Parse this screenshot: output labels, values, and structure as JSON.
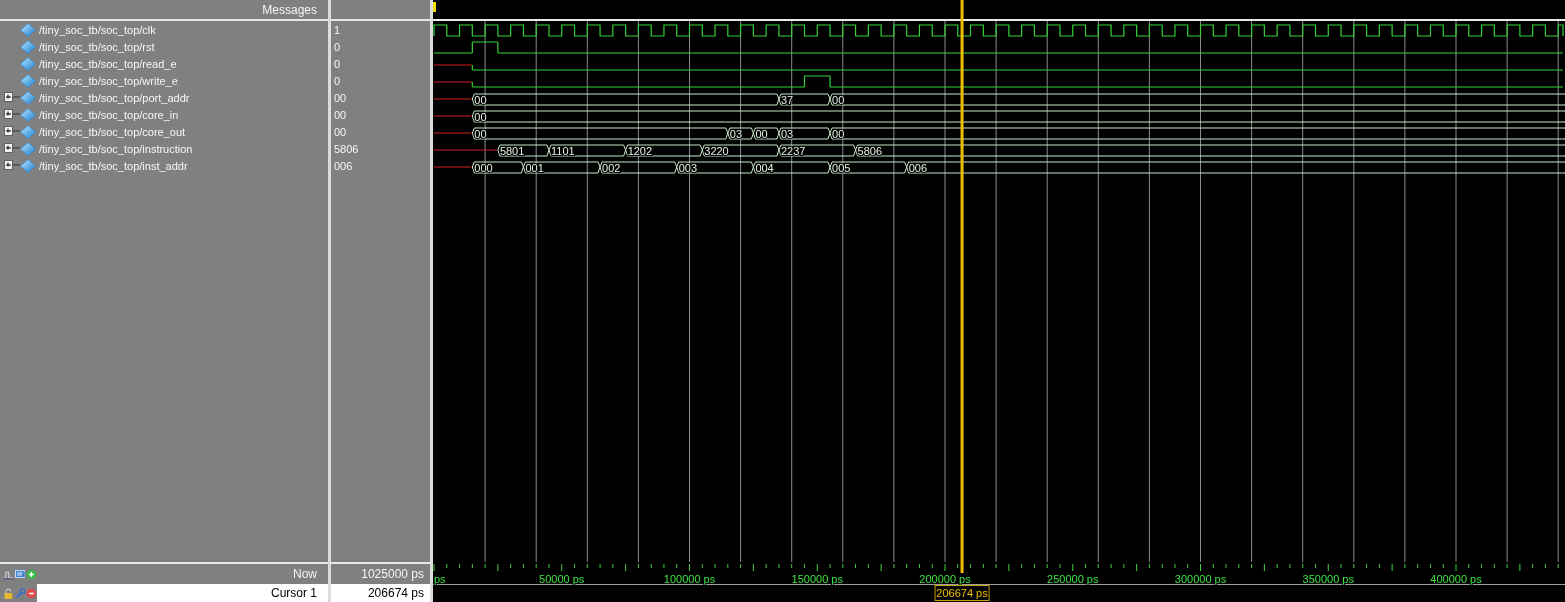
{
  "header": {
    "title": "Messages"
  },
  "signals": [
    {
      "name": "/tiny_soc_tb/soc_top/clk",
      "value": "1",
      "kind": "clock"
    },
    {
      "name": "/tiny_soc_tb/soc_top/rst",
      "value": "0",
      "kind": "bit"
    },
    {
      "name": "/tiny_soc_tb/soc_top/read_e",
      "value": "0",
      "kind": "bit"
    },
    {
      "name": "/tiny_soc_tb/soc_top/write_e",
      "value": "0",
      "kind": "bit"
    },
    {
      "name": "/tiny_soc_tb/soc_top/port_addr",
      "value": "00",
      "kind": "bus",
      "expanded": false,
      "segments": [
        {
          "value": "00"
        },
        {
          "value": "37"
        },
        {
          "value": "00"
        }
      ]
    },
    {
      "name": "/tiny_soc_tb/soc_top/core_in",
      "value": "00",
      "kind": "bus",
      "expanded": false,
      "segments": [
        {
          "value": "00"
        }
      ]
    },
    {
      "name": "/tiny_soc_tb/soc_top/core_out",
      "value": "00",
      "kind": "bus",
      "expanded": false,
      "segments": [
        {
          "value": "00"
        },
        {
          "value": "03"
        },
        {
          "value": "00"
        },
        {
          "value": "03"
        },
        {
          "value": "00"
        }
      ]
    },
    {
      "name": "/tiny_soc_tb/soc_top/instruction",
      "value": "5806",
      "kind": "bus",
      "expanded": false,
      "segments": [
        {
          "value": "5801"
        },
        {
          "value": "1101"
        },
        {
          "value": "1202"
        },
        {
          "value": "3220"
        },
        {
          "value": "2237"
        },
        {
          "value": "5806"
        }
      ]
    },
    {
      "name": "/tiny_soc_tb/soc_top/inst_addr",
      "value": "006",
      "kind": "bus",
      "expanded": false,
      "segments": [
        {
          "value": "000"
        },
        {
          "value": "001"
        },
        {
          "value": "002"
        },
        {
          "value": "003"
        },
        {
          "value": "004"
        },
        {
          "value": "005"
        },
        {
          "value": "006"
        }
      ]
    }
  ],
  "timeline": {
    "ticks": [
      "ps",
      "50000 ps",
      "100000 ps",
      "150000 ps",
      "200000 ps",
      "250000 ps",
      "300000 ps",
      "350000 ps",
      "400000 ps"
    ]
  },
  "now": {
    "label": "Now",
    "value": "1025000 ps"
  },
  "cursor": {
    "label": "Cursor 1",
    "value": "206674 ps",
    "time": "206674 ps"
  }
}
